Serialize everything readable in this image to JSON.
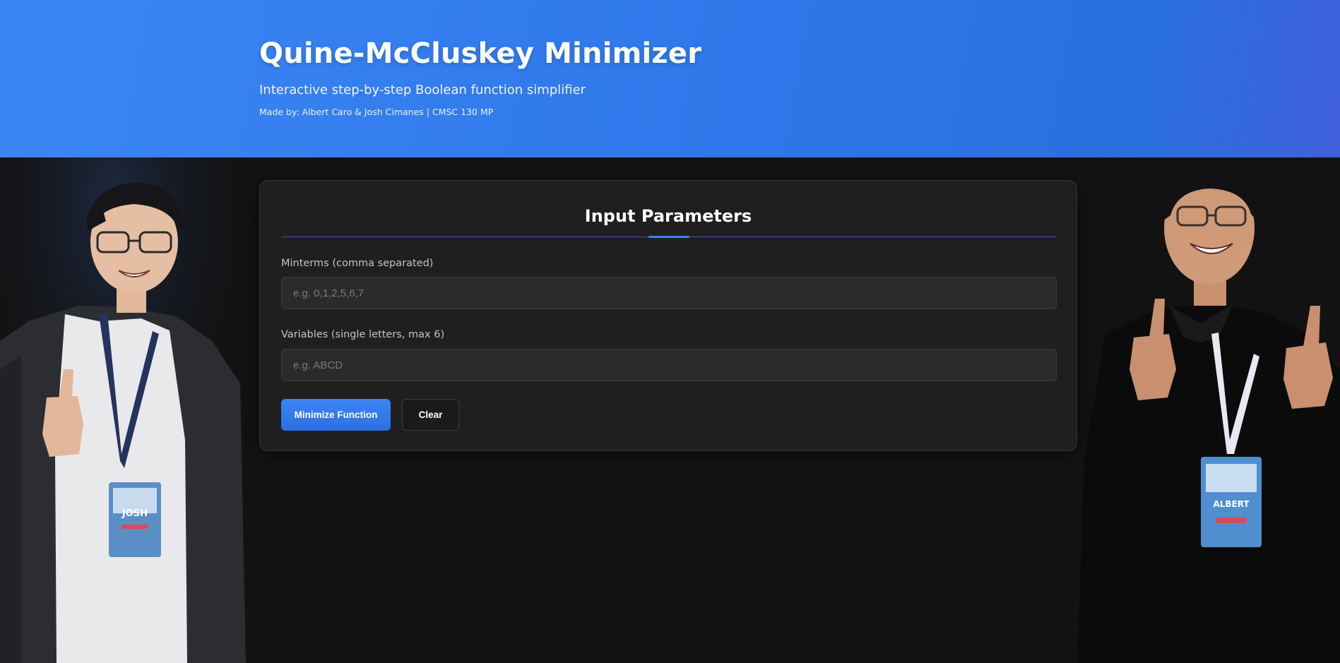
{
  "header": {
    "title": "Quine-McCluskey Minimizer",
    "subtitle": "Interactive step-by-step Boolean function simplifier",
    "credits": "Made by: Albert Caro & Josh Cimanes | CMSC 130 MP"
  },
  "card": {
    "title": "Input Parameters",
    "minterms": {
      "label": "Minterms (comma separated)",
      "value": "",
      "placeholder": "e.g. 0,1,2,5,6,7"
    },
    "variables": {
      "label": "Variables (single letters, max 6)",
      "value": "",
      "placeholder": "e.g. ABCD"
    },
    "buttons": {
      "minimize": "Minimize Function",
      "clear": "Clear"
    }
  },
  "photos": {
    "left_badge": "JOSH",
    "right_badge": "ALBERT"
  },
  "colors": {
    "header_blue": "#3b86f5",
    "accent": "#3b82f6",
    "background": "#121212",
    "card": "#1f1f1f"
  }
}
